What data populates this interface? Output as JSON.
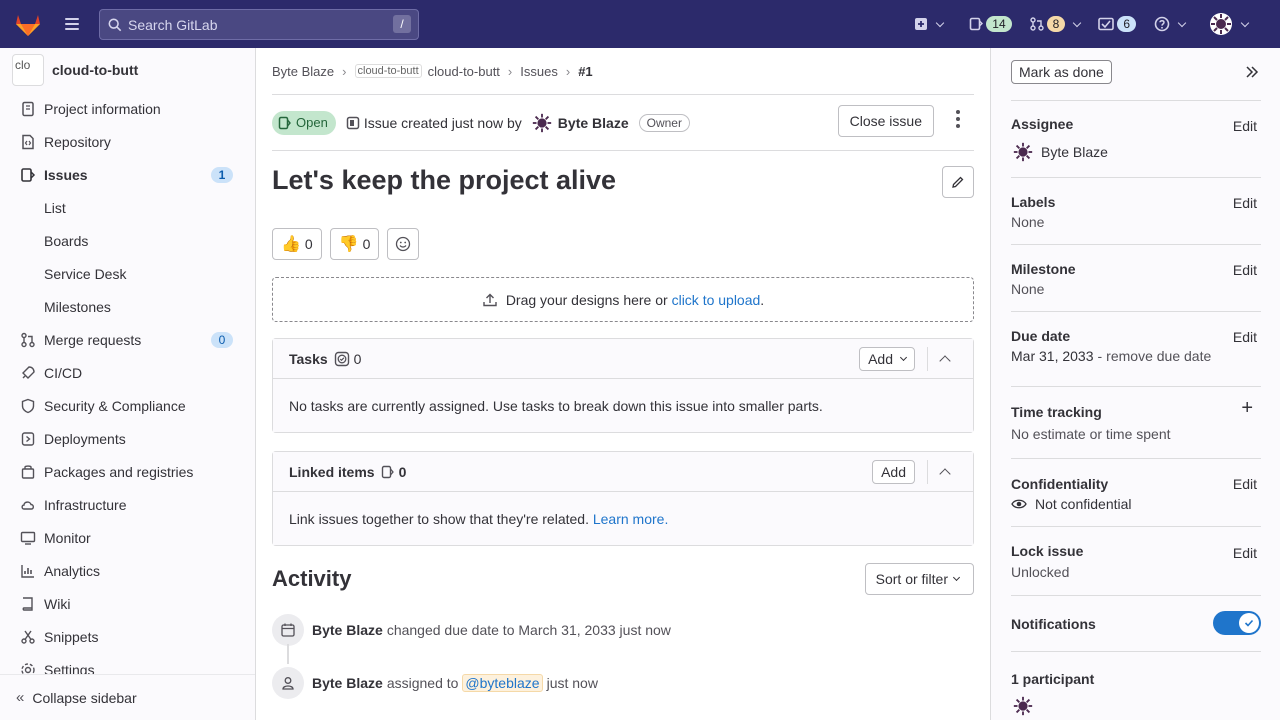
{
  "topbar": {
    "search_placeholder": "Search GitLab",
    "search_shortcut": "/",
    "issues_count": "14",
    "mr_count": "8",
    "todos_count": "6",
    "colors": {
      "bg": "#2c2a6b",
      "issues_badge": "#c3e6cd",
      "mr_badge": "#f5d9a8",
      "todos_badge": "#cbe2f9"
    }
  },
  "sidebar": {
    "project_avatar_alt": "clo",
    "project_name": "cloud-to-butt",
    "items": [
      {
        "label": "Project information",
        "icon": "project-icon"
      },
      {
        "label": "Repository",
        "icon": "doc-code-icon"
      },
      {
        "label": "Issues",
        "icon": "issues-icon",
        "count": "1"
      },
      {
        "label": "List",
        "sub": true
      },
      {
        "label": "Boards",
        "sub": true
      },
      {
        "label": "Service Desk",
        "sub": true
      },
      {
        "label": "Milestones",
        "sub": true
      },
      {
        "label": "Merge requests",
        "icon": "merge-request-icon",
        "count": "0"
      },
      {
        "label": "CI/CD",
        "icon": "rocket-icon"
      },
      {
        "label": "Security & Compliance",
        "icon": "shield-icon"
      },
      {
        "label": "Deployments",
        "icon": "deployments-icon"
      },
      {
        "label": "Packages and registries",
        "icon": "package-icon"
      },
      {
        "label": "Infrastructure",
        "icon": "cloud-gear-icon"
      },
      {
        "label": "Monitor",
        "icon": "monitor-icon"
      },
      {
        "label": "Analytics",
        "icon": "chart-icon"
      },
      {
        "label": "Wiki",
        "icon": "book-icon"
      },
      {
        "label": "Snippets",
        "icon": "snippet-icon"
      },
      {
        "label": "Settings",
        "icon": "settings-icon"
      }
    ],
    "collapse_label": "Collapse sidebar"
  },
  "breadcrumb": {
    "items": [
      "Byte Blaze",
      "cloud-to-butt",
      "Issues",
      "#1"
    ],
    "image_alt": "cloud-to-butt"
  },
  "issue": {
    "status": "Open",
    "created_text": "Issue created just now by",
    "author": "Byte Blaze",
    "author_role": "Owner",
    "close_label": "Close issue",
    "title": "Let's keep the project alive",
    "thumbs_up": "0",
    "thumbs_down": "0",
    "upload_text": "Drag your designs here or",
    "upload_link": "click to upload",
    "upload_suffix": "."
  },
  "tasks": {
    "title": "Tasks",
    "count": "0",
    "add_label": "Add",
    "empty_text": "No tasks are currently assigned. Use tasks to break down this issue into smaller parts."
  },
  "linked": {
    "title": "Linked items",
    "count": "0",
    "add_label": "Add",
    "body_text": "Link issues together to show that they're related.",
    "learn_more": "Learn more."
  },
  "activity": {
    "title": "Activity",
    "sort_label": "Sort or filter",
    "notes": [
      {
        "author": "Byte Blaze",
        "text": "changed due date to March 31, 2033 just now",
        "icon": "calendar-icon"
      },
      {
        "author": "Byte Blaze",
        "text_before": "assigned to",
        "mention": "@byteblaze",
        "text_after": "just now",
        "icon": "user-icon"
      }
    ]
  },
  "right_sidebar": {
    "mark_done": "Mark as done",
    "assignee_label": "Assignee",
    "assignee": "Byte Blaze",
    "labels_label": "Labels",
    "labels_value": "None",
    "milestone_label": "Milestone",
    "milestone_value": "None",
    "due_label": "Due date",
    "due_value": "Mar 31, 2033",
    "due_remove": "remove due date",
    "time_label": "Time tracking",
    "time_value": "No estimate or time spent",
    "conf_label": "Confidentiality",
    "conf_value": "Not confidential",
    "lock_label": "Lock issue",
    "lock_value": "Unlocked",
    "notif_label": "Notifications",
    "notif_on": true,
    "participants_label": "1 participant",
    "edit_label": "Edit"
  }
}
